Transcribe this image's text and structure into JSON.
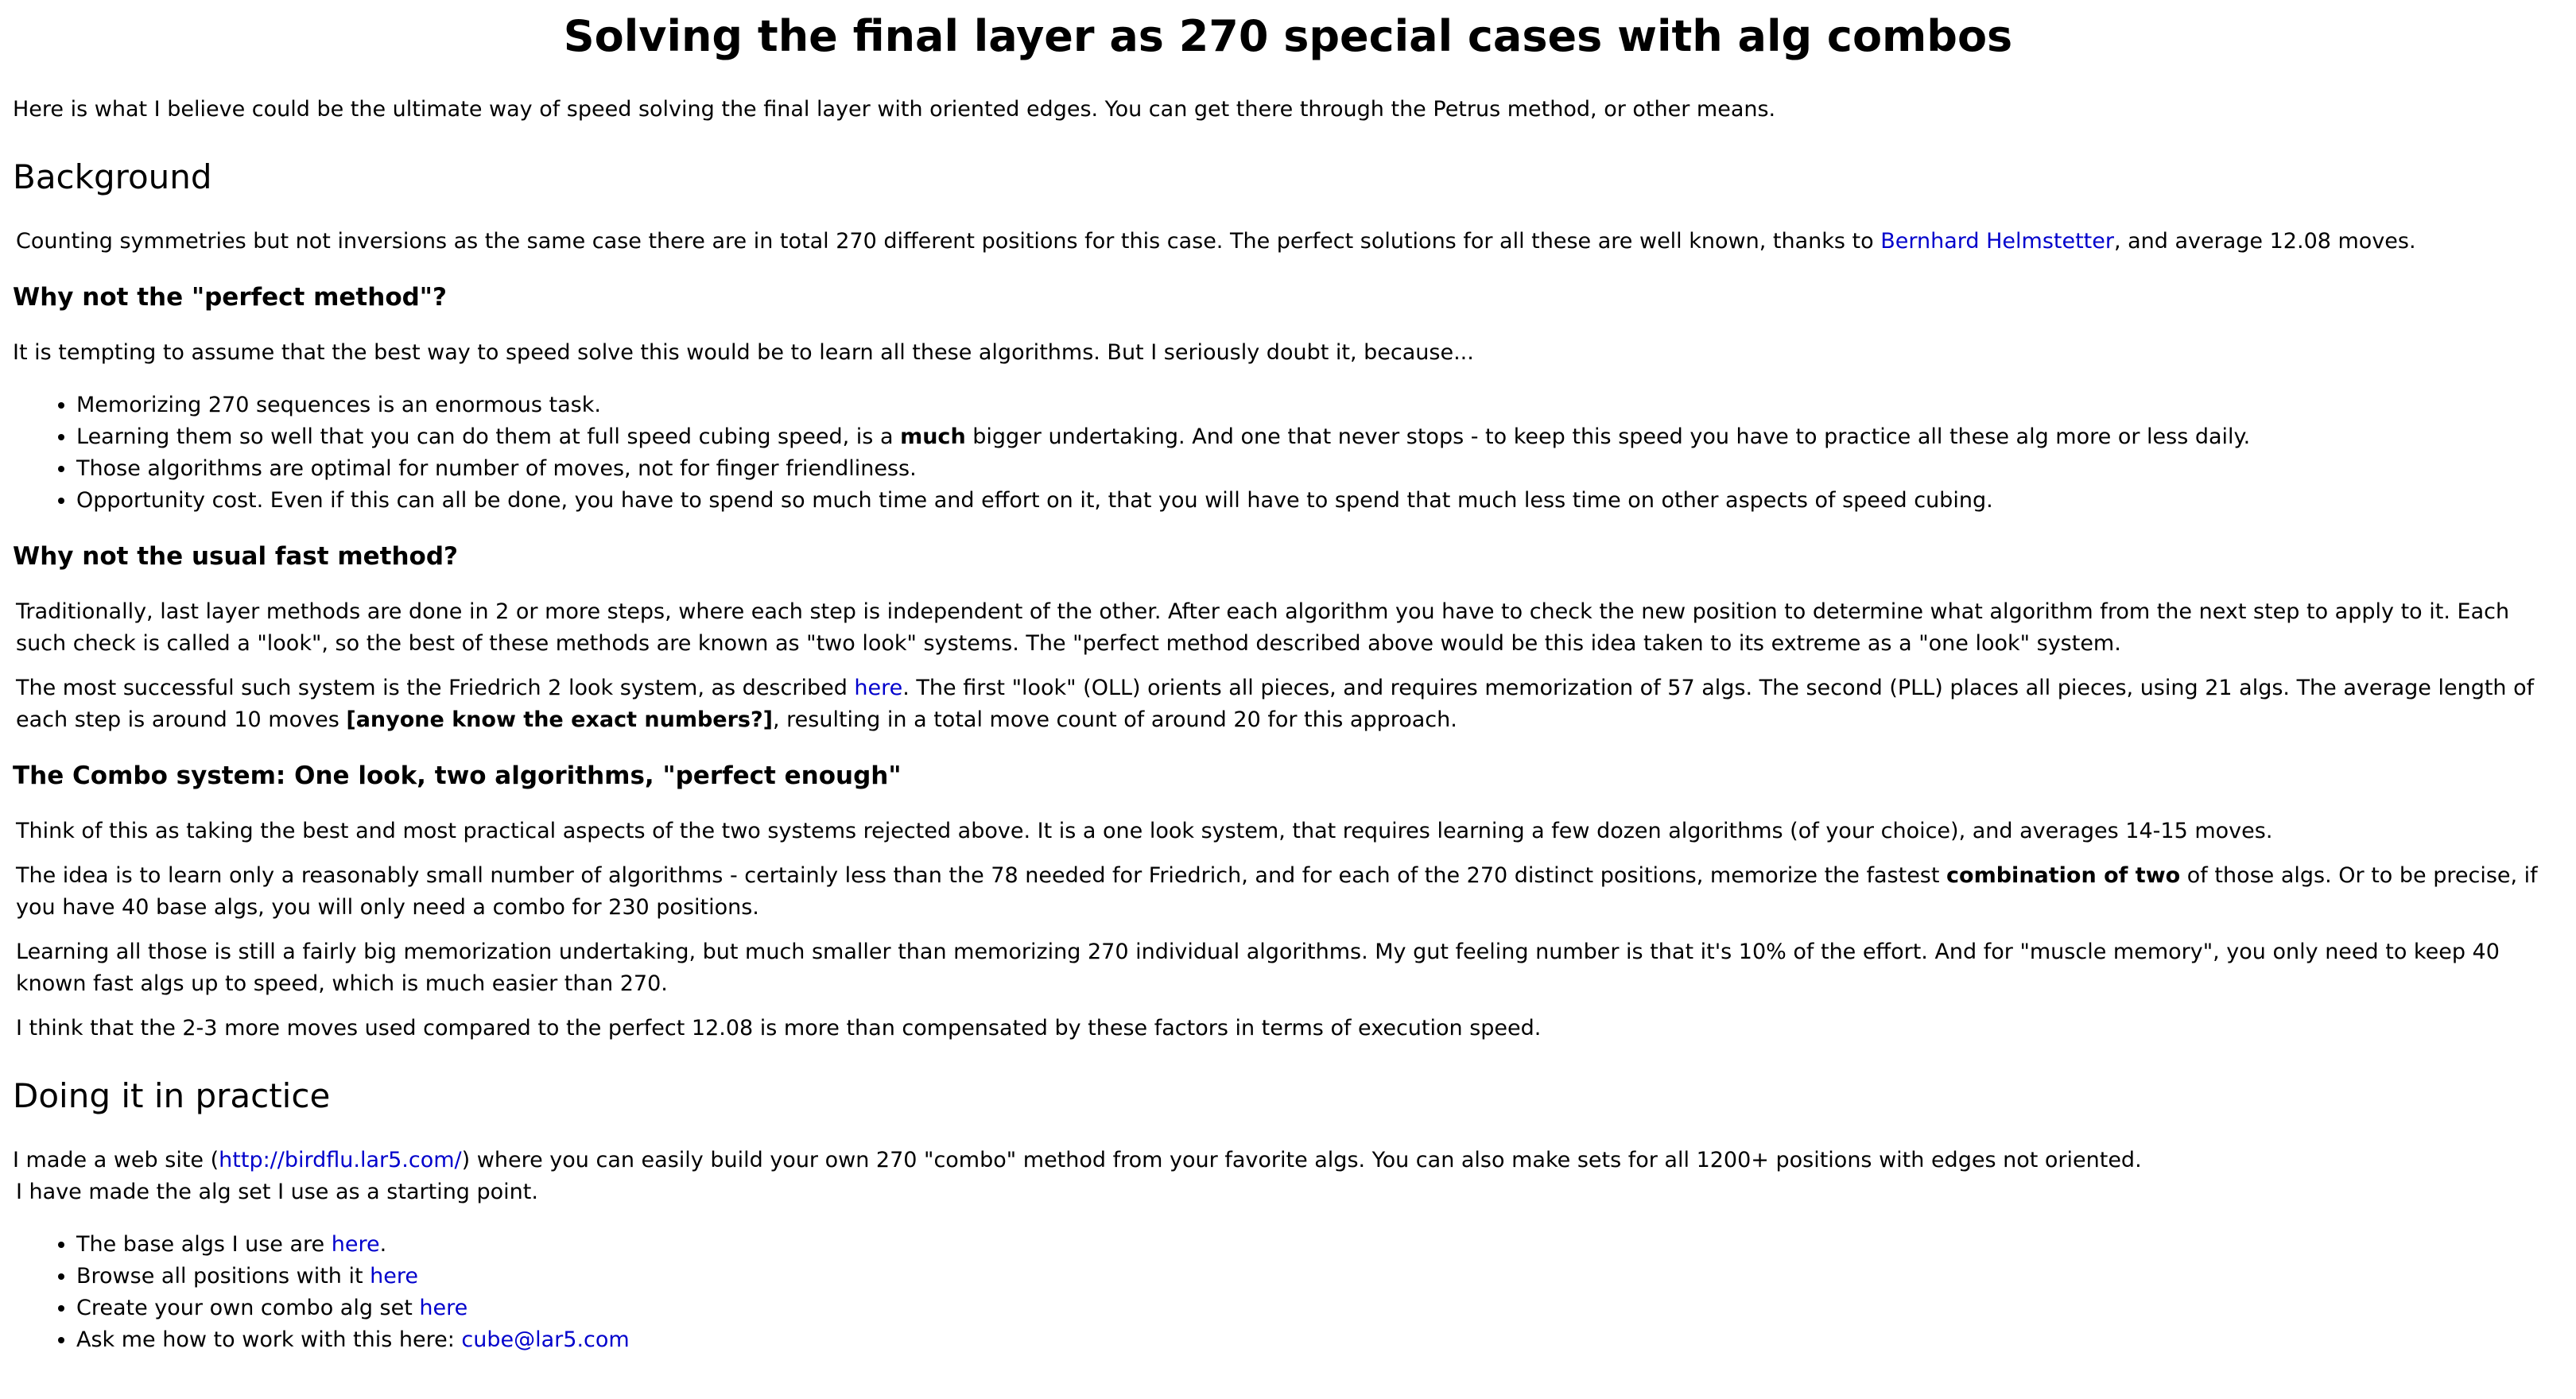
{
  "title": "Solving the final layer as 270 special cases with alg combos",
  "intro": "Here is what I believe could be the ultimate way of speed solving the final layer with oriented edges. You can get there through the Petrus method, or other means.",
  "background": {
    "heading": "Background",
    "p1_before": "Counting symmetries but not inversions as the same case there are in total 270 different positions for this case. The perfect solutions for all these are well known, thanks to ",
    "p1_link": "Bernhard Helmstetter",
    "p1_after": ", and average 12.08 moves."
  },
  "why_not_perfect": {
    "heading": "Why not the \"perfect method\"?",
    "p1": "It is tempting to assume that the best way to speed solve this would be to learn all these algorithms. But I seriously doubt it, because...",
    "bullets": [
      {
        "text": "Memorizing 270 sequences is an enormous task."
      },
      {
        "before": "Learning them so well that you can do them at full speed cubing speed, is a ",
        "bold": "much",
        "after": " bigger undertaking. And one that never stops - to keep this speed you have to practice all these alg more or less daily."
      },
      {
        "text": "Those algorithms are optimal for number of moves, not for finger friendliness."
      },
      {
        "text": "Opportunity cost. Even if this can all be done, you have to spend so much time and effort on it, that you will have to spend that much less time on other aspects of speed cubing."
      }
    ]
  },
  "why_not_usual": {
    "heading": "Why not the usual fast method?",
    "p1": "Traditionally, last layer methods are done in 2 or more steps, where each step is independent of the other. After each algorithm you have to check the new position to determine what algorithm from the next step to apply to it. Each such check is called a \"look\", so the best of these methods are known as \"two look\" systems. The \"perfect method described above would be this idea taken to its extreme as a \"one look\" system.",
    "p2_before": "The most successful such system is the Friedrich 2 look system, as described ",
    "p2_link": "here",
    "p2_mid": ". The first \"look\" (OLL) orients all pieces, and requires memorization of 57 algs. The second (PLL) places all pieces, using 21 algs. The average length of each step is around 10 moves ",
    "p2_bold": "[anyone know the exact numbers?]",
    "p2_after": ", resulting in a total move count of around 20 for this approach."
  },
  "combo": {
    "heading": "The Combo system: One look, two algorithms, \"perfect enough\"",
    "p1": "Think of this as taking the best and most practical aspects of the two systems rejected above. It is a one look system, that requires learning a few dozen algorithms (of your choice), and averages 14-15 moves.",
    "p2_before": "The idea is to learn only a reasonably small number of algorithms - certainly less than the 78 needed for Friedrich, and for each of the 270 distinct positions, memorize the fastest ",
    "p2_bold": "combination of two",
    "p2_after": " of those algs. Or to be precise, if you have 40 base algs, you will only need a combo for 230 positions.",
    "p3": "Learning all those is still a fairly big memorization undertaking, but much smaller than memorizing 270 individual algorithms. My gut feeling number is that it's 10% of the effort. And for \"muscle memory\", you only need to keep 40 known fast algs up to speed, which is much easier than 270.",
    "p4": "I think that the 2-3 more moves used compared to the perfect 12.08 is more than compensated by these factors in terms of execution speed."
  },
  "practice": {
    "heading": "Doing it in practice",
    "p1_before": "I made a web site (",
    "p1_link": "http://birdflu.lar5.com/",
    "p1_after": ") where you can easily build your own 270 \"combo\" method from your favorite algs. You can also make sets for all 1200+ positions with edges not oriented.",
    "p2": "I have made the alg set I use as a starting point.",
    "bullets": [
      {
        "before": "The base algs I use are ",
        "link": "here",
        "after": "."
      },
      {
        "before": "Browse all positions with it ",
        "link": "here",
        "after": ""
      },
      {
        "before": "Create your own combo alg set ",
        "link": "here",
        "after": ""
      },
      {
        "before": "Ask me how to work with this here: ",
        "link": "cube@lar5.com",
        "after": ""
      }
    ]
  },
  "colors": {
    "link": "#0000cc",
    "text": "#000000",
    "background": "#ffffff"
  }
}
